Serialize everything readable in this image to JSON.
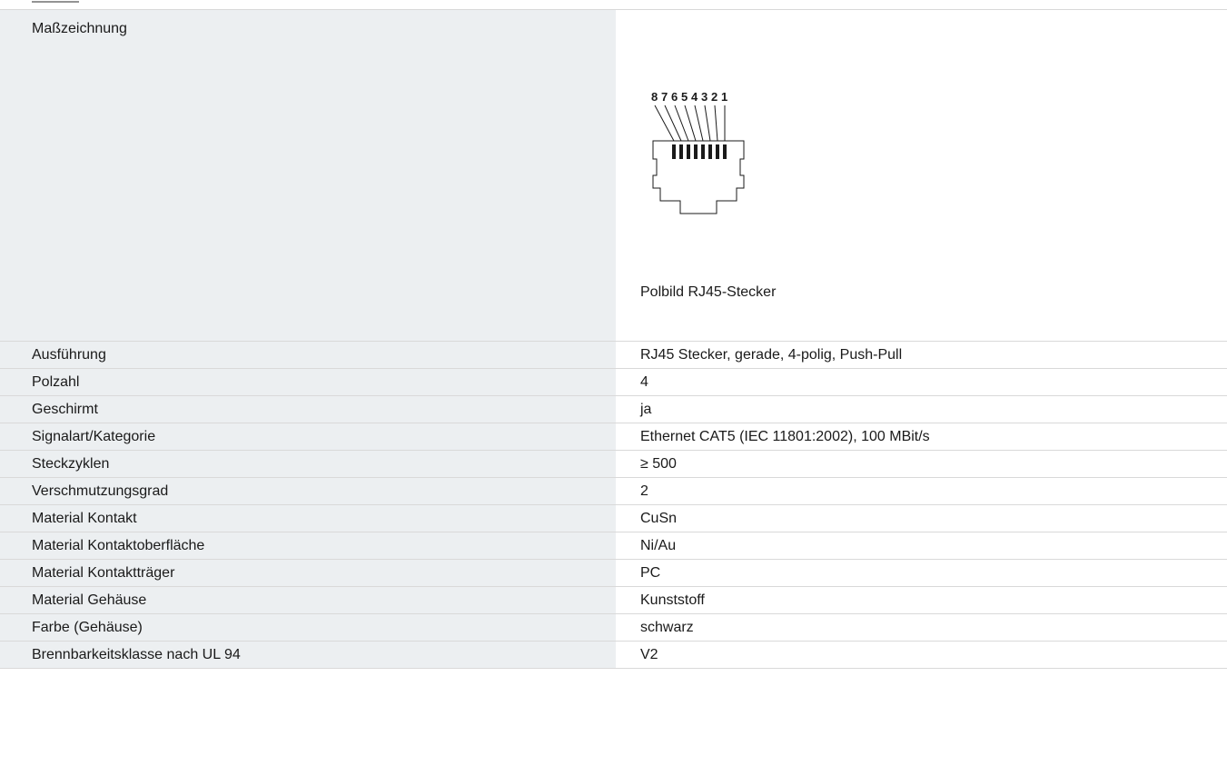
{
  "drawing_section": {
    "label": "Maßzeichnung",
    "pin_numbers": [
      "8",
      "7",
      "6",
      "5",
      "4",
      "3",
      "2",
      "1"
    ],
    "caption": "Polbild RJ45-Stecker"
  },
  "specs": [
    {
      "label": "Ausführung",
      "value": "RJ45 Stecker, gerade, 4-polig, Push-Pull"
    },
    {
      "label": "Polzahl",
      "value": "4"
    },
    {
      "label": "Geschirmt",
      "value": "ja"
    },
    {
      "label": "Signalart/Kategorie",
      "value": "Ethernet CAT5 (IEC 11801:2002), 100 MBit/s"
    },
    {
      "label": "Steckzyklen",
      "value": "≥ 500"
    },
    {
      "label": "Verschmutzungsgrad",
      "value": "2"
    },
    {
      "label": "Material Kontakt",
      "value": "CuSn"
    },
    {
      "label": "Material Kontaktoberfläche",
      "value": "Ni/Au"
    },
    {
      "label": "Material Kontaktträger",
      "value": "PC"
    },
    {
      "label": "Material Gehäuse",
      "value": "Kunststoff"
    },
    {
      "label": "Farbe (Gehäuse)",
      "value": "schwarz"
    },
    {
      "label": "Brennbarkeitsklasse nach UL 94",
      "value": "V2"
    }
  ]
}
